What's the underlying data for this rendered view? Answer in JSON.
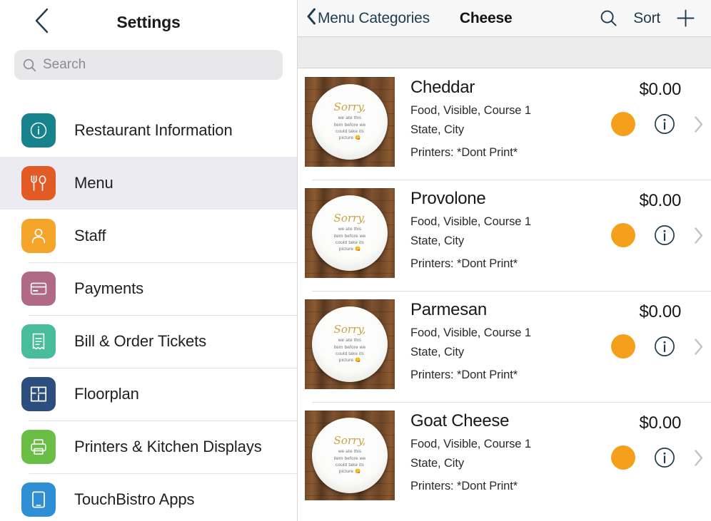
{
  "sidebar": {
    "back_icon": "chevron-left-icon",
    "title": "Settings",
    "search": {
      "icon": "search-icon",
      "value": "",
      "placeholder": "Search"
    },
    "items": [
      {
        "label": "Restaurant Information",
        "icon": "info-circle-icon",
        "color": "#16838C",
        "selected": false
      },
      {
        "label": "Menu",
        "icon": "fork-spoon-icon",
        "color": "#E35B24",
        "selected": true
      },
      {
        "label": "Staff",
        "icon": "person-icon",
        "color": "#F5A62A",
        "selected": false
      },
      {
        "label": "Payments",
        "icon": "credit-card-icon",
        "color": "#B06A85",
        "selected": false
      },
      {
        "label": "Bill & Order Tickets",
        "icon": "receipt-icon",
        "color": "#49BD9B",
        "selected": false
      },
      {
        "label": "Floorplan",
        "icon": "floorplan-icon",
        "color": "#2B4E7E",
        "selected": false
      },
      {
        "label": "Printers & Kitchen Displays",
        "icon": "printer-icon",
        "color": "#6BBE45",
        "selected": false
      },
      {
        "label": "TouchBistro Apps",
        "icon": "tablet-icon",
        "color": "#2E8FD4",
        "selected": false
      }
    ]
  },
  "panel": {
    "nav": {
      "back_icon": "chevron-left-icon",
      "back_label": "Menu Categories",
      "title": "Cheese",
      "search_icon": "search-icon",
      "sort_label": "Sort",
      "add_icon": "plus-icon"
    },
    "thumbnail": {
      "sorry": "Sorry,",
      "line1": "we ate this",
      "line2": "item before we",
      "line3": "could take its",
      "line4": "picture",
      "emoji": "😋"
    },
    "colors": {
      "status_dot": "#F5A01C",
      "info_icon": "#1E3C4E",
      "chevron": "#c3c3c6",
      "nav_text": "#1E3C4E"
    },
    "items": [
      {
        "name": "Cheddar",
        "price": "$0.00",
        "meta_line1": "Food, Visible, Course 1",
        "meta_line2": "State, City",
        "printers": "Printers: *Dont Print*",
        "status_icon": "status-dot",
        "info_icon": "info-circle-icon",
        "chevron_icon": "chevron-right-icon"
      },
      {
        "name": "Provolone",
        "price": "$0.00",
        "meta_line1": "Food, Visible, Course 1",
        "meta_line2": "State, City",
        "printers": "Printers: *Dont Print*",
        "status_icon": "status-dot",
        "info_icon": "info-circle-icon",
        "chevron_icon": "chevron-right-icon"
      },
      {
        "name": "Parmesan",
        "price": "$0.00",
        "meta_line1": "Food, Visible, Course 1",
        "meta_line2": "State, City",
        "printers": "Printers: *Dont Print*",
        "status_icon": "status-dot",
        "info_icon": "info-circle-icon",
        "chevron_icon": "chevron-right-icon"
      },
      {
        "name": "Goat Cheese",
        "price": "$0.00",
        "meta_line1": "Food, Visible, Course 1",
        "meta_line2": "State, City",
        "printers": "Printers: *Dont Print*",
        "status_icon": "status-dot",
        "info_icon": "info-circle-icon",
        "chevron_icon": "chevron-right-icon"
      }
    ]
  }
}
